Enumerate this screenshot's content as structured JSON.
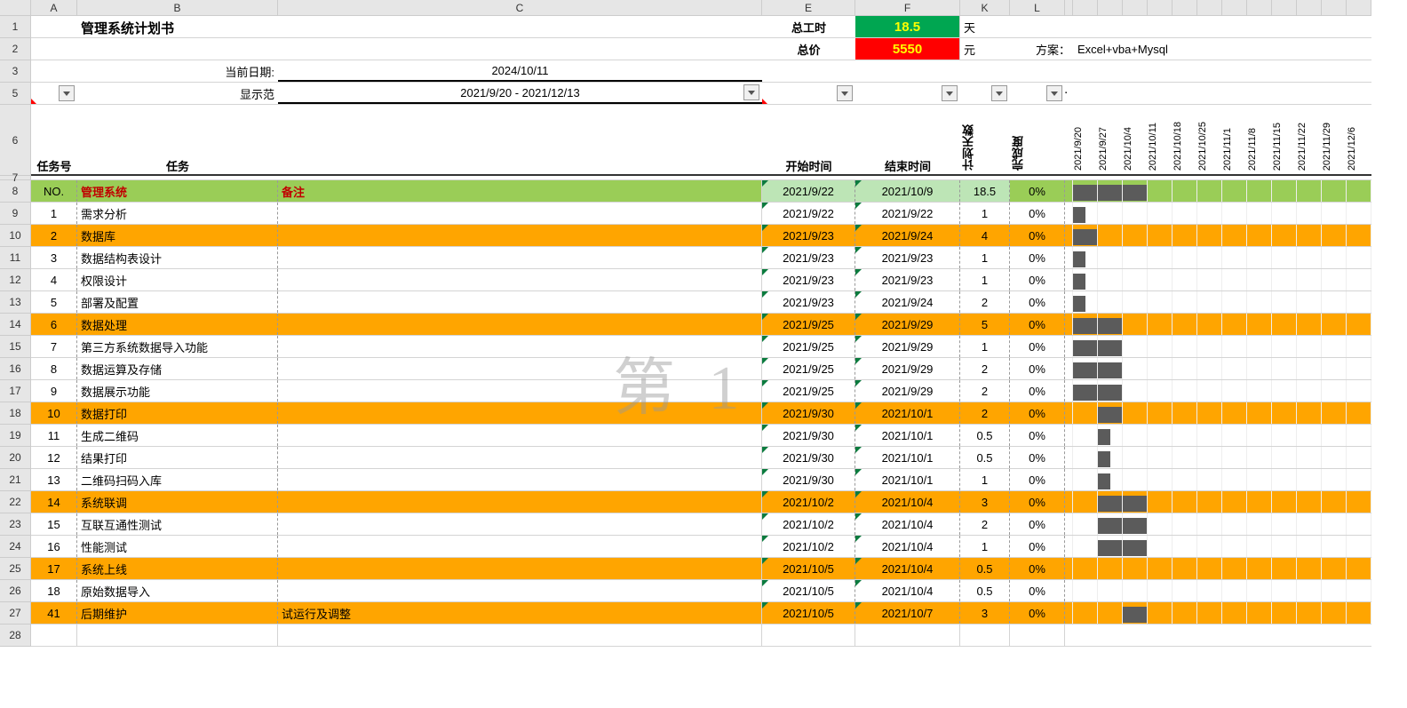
{
  "columns": [
    "A",
    "B",
    "C",
    "E",
    "F",
    "K",
    "L"
  ],
  "top_labels": {
    "hours": "总工时",
    "price": "总价",
    "hours_val": "18.5",
    "price_val": "5550",
    "days_unit": "天",
    "yuan_unit": "元",
    "scheme_lbl": "方案：",
    "scheme_val": "Excel+vba+Mysql"
  },
  "title": "管理系统计划书",
  "cur_date_lbl": "当前日期:",
  "cur_date": "2024/10/11",
  "range_lbl": "显示范",
  "range_val": "2021/9/20 - 2021/12/13",
  "headers": {
    "taskno": "任务号",
    "task": "任务",
    "start": "开始时间",
    "end": "结束时间",
    "days": "计划天数",
    "comp": "完成度"
  },
  "dates": [
    "2021/9/20",
    "2021/9/27",
    "2021/10/4",
    "2021/10/11",
    "2021/10/18",
    "2021/10/25",
    "2021/11/1",
    "2021/11/8",
    "2021/11/15",
    "2021/11/22",
    "2021/11/29",
    "2021/12/6"
  ],
  "cat_no": "NO.",
  "cat_b": "管理系统",
  "cat_c": "备注",
  "rows": [
    {
      "no": "NO.",
      "task": "管理系统",
      "rem": "备注",
      "start": "2021/9/22",
      "end": "2021/10/9",
      "days": "18.5",
      "comp": "0%",
      "cat": "green",
      "bar": [
        0,
        1,
        2
      ]
    },
    {
      "no": "1",
      "task": "需求分析",
      "rem": "",
      "start": "2021/9/22",
      "end": "2021/9/22",
      "days": "1",
      "comp": "0%",
      "bar": [
        0
      ]
    },
    {
      "no": "2",
      "task": "数据库",
      "rem": "",
      "start": "2021/9/23",
      "end": "2021/9/24",
      "days": "4",
      "comp": "0%",
      "cat": "or",
      "bar": [
        0
      ]
    },
    {
      "no": "3",
      "task": "数据结构表设计",
      "rem": "",
      "start": "2021/9/23",
      "end": "2021/9/23",
      "days": "1",
      "comp": "0%",
      "bar": [
        0
      ]
    },
    {
      "no": "4",
      "task": "权限设计",
      "rem": "",
      "start": "2021/9/23",
      "end": "2021/9/23",
      "days": "1",
      "comp": "0%",
      "bar": [
        0
      ]
    },
    {
      "no": "5",
      "task": "部署及配置",
      "rem": "",
      "start": "2021/9/23",
      "end": "2021/9/24",
      "days": "2",
      "comp": "0%",
      "bar": [
        0
      ]
    },
    {
      "no": "6",
      "task": "数据处理",
      "rem": "",
      "start": "2021/9/25",
      "end": "2021/9/29",
      "days": "5",
      "comp": "0%",
      "cat": "or",
      "bar": [
        0,
        1
      ]
    },
    {
      "no": "7",
      "task": "第三方系统数据导入功能",
      "rem": "",
      "start": "2021/9/25",
      "end": "2021/9/29",
      "days": "1",
      "comp": "0%",
      "bar": [
        0,
        1
      ]
    },
    {
      "no": "8",
      "task": "数据运算及存储",
      "rem": "",
      "start": "2021/9/25",
      "end": "2021/9/29",
      "days": "2",
      "comp": "0%",
      "bar": [
        0,
        1
      ]
    },
    {
      "no": "9",
      "task": "数据展示功能",
      "rem": "",
      "start": "2021/9/25",
      "end": "2021/9/29",
      "days": "2",
      "comp": "0%",
      "bar": [
        0,
        1
      ]
    },
    {
      "no": "10",
      "task": "数据打印",
      "rem": "",
      "start": "2021/9/30",
      "end": "2021/10/1",
      "days": "2",
      "comp": "0%",
      "cat": "or",
      "bar": [
        1
      ]
    },
    {
      "no": "11",
      "task": "生成二维码",
      "rem": "",
      "start": "2021/9/30",
      "end": "2021/10/1",
      "days": "0.5",
      "comp": "0%",
      "bar": [
        1
      ]
    },
    {
      "no": "12",
      "task": "结果打印",
      "rem": "",
      "start": "2021/9/30",
      "end": "2021/10/1",
      "days": "0.5",
      "comp": "0%",
      "bar": [
        1
      ]
    },
    {
      "no": "13",
      "task": "二维码扫码入库",
      "rem": "",
      "start": "2021/9/30",
      "end": "2021/10/1",
      "days": "1",
      "comp": "0%",
      "bar": [
        1
      ]
    },
    {
      "no": "14",
      "task": "系统联调",
      "rem": "",
      "start": "2021/10/2",
      "end": "2021/10/4",
      "days": "3",
      "comp": "0%",
      "cat": "or",
      "bar": [
        1,
        2
      ]
    },
    {
      "no": "15",
      "task": "互联互通性测试",
      "rem": "",
      "start": "2021/10/2",
      "end": "2021/10/4",
      "days": "2",
      "comp": "0%",
      "bar": [
        1,
        2
      ]
    },
    {
      "no": "16",
      "task": "性能测试",
      "rem": "",
      "start": "2021/10/2",
      "end": "2021/10/4",
      "days": "1",
      "comp": "0%",
      "bar": [
        1,
        2
      ]
    },
    {
      "no": "17",
      "task": "系统上线",
      "rem": "",
      "start": "2021/10/5",
      "end": "2021/10/4",
      "days": "0.5",
      "comp": "0%",
      "cat": "or",
      "bar": []
    },
    {
      "no": "18",
      "task": "原始数据导入",
      "rem": "",
      "start": "2021/10/5",
      "end": "2021/10/4",
      "days": "0.5",
      "comp": "0%",
      "bar": []
    },
    {
      "no": "41",
      "task": "后期维护",
      "rem": "试运行及调整",
      "start": "2021/10/5",
      "end": "2021/10/7",
      "days": "3",
      "comp": "0%",
      "cat": "or",
      "bar": [
        2
      ]
    }
  ],
  "row_nums": [
    "1",
    "2",
    "3",
    "5",
    "6",
    "7",
    "8",
    "9",
    "10",
    "11",
    "12",
    "13",
    "14",
    "15",
    "16",
    "17",
    "18",
    "19",
    "20",
    "21",
    "22",
    "23",
    "24",
    "25",
    "26",
    "27",
    "28"
  ],
  "tiny": "▪"
}
